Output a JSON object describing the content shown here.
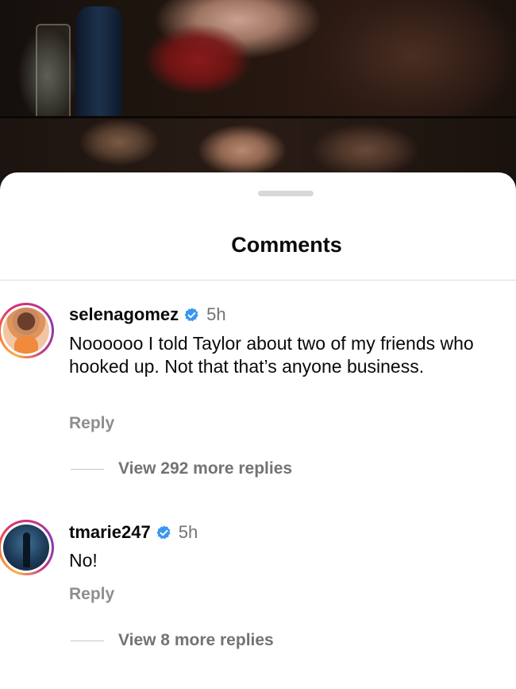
{
  "sheet": {
    "title": "Comments"
  },
  "comments": [
    {
      "username": "selenagomez",
      "time": "5h",
      "text": "Noooooo I told Taylor about two of my friends who hooked up. Not that that’s anyone business.",
      "reply_label": "Reply",
      "view_replies_label": "View 292 more replies"
    },
    {
      "username": "tmarie247",
      "time": "5h",
      "text": "No!",
      "reply_label": "Reply",
      "view_replies_label": "View 8 more replies"
    }
  ],
  "colors": {
    "verified_badge": "#3897f0",
    "muted_text": "#737373",
    "reply_text": "#8e8e8e"
  }
}
